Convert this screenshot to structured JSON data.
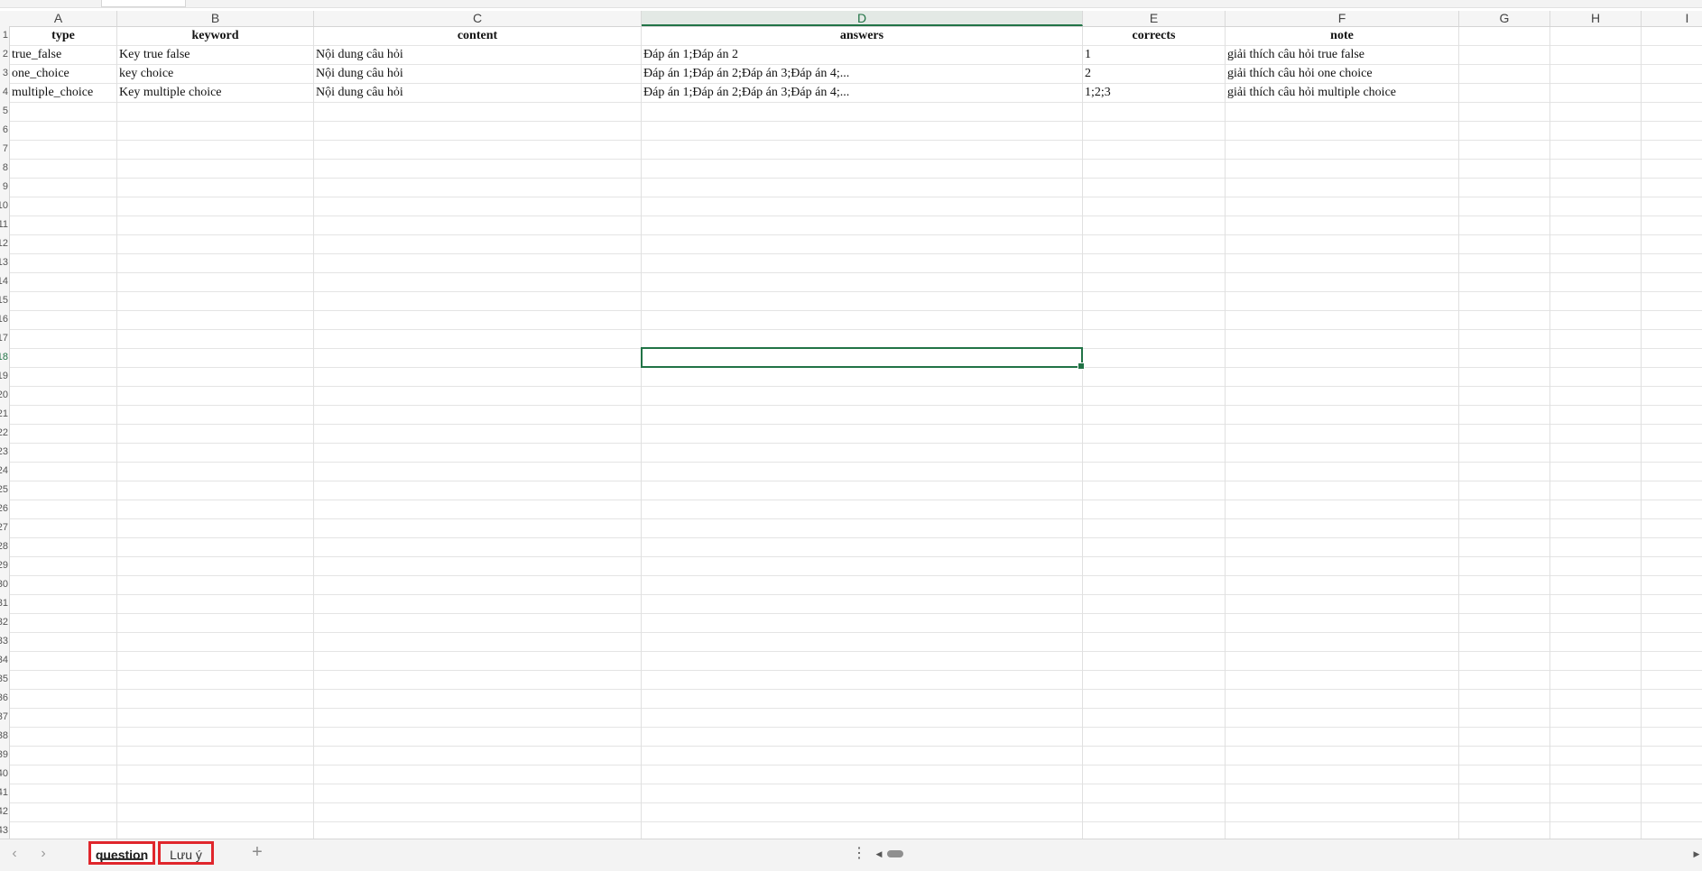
{
  "columns": [
    "A",
    "B",
    "C",
    "D",
    "E",
    "F",
    "G",
    "H",
    "I"
  ],
  "selected_column": "D",
  "header_row": {
    "type": "type",
    "keyword": "keyword",
    "content": "content",
    "answers": "answers",
    "corrects": "corrects",
    "note": "note"
  },
  "rows": [
    {
      "type": "true_false",
      "keyword": "Key true false",
      "content": "Nội dung câu hỏi",
      "answers": "Đáp án 1;Đáp án 2",
      "corrects": "1",
      "note": "giải thích câu hỏi true false"
    },
    {
      "type": "one_choice",
      "keyword": "key choice",
      "content": "Nội dung câu hỏi",
      "answers": "Đáp án 1;Đáp án 2;Đáp án 3;Đáp án 4;...",
      "corrects": "2",
      "note": "giải thích câu hỏi one choice"
    },
    {
      "type": "multiple_choice",
      "keyword": "Key multiple choice",
      "content": "Nội dung câu hỏi",
      "answers": "Đáp án 1;Đáp án 2;Đáp án 3;Đáp án 4;...",
      "corrects": "1;2;3",
      "note": "giải thích câu hỏi multiple choice"
    }
  ],
  "row_numbers": [
    "1",
    "2",
    "3",
    "4",
    "5",
    "6",
    "7",
    "8",
    "9",
    "10",
    "11",
    "12",
    "13",
    "14",
    "15",
    "16",
    "17",
    "18",
    "19",
    "20",
    "21",
    "22",
    "23",
    "24",
    "25",
    "26",
    "27",
    "28",
    "29",
    "30",
    "31",
    "32",
    "33",
    "34",
    "35",
    "36",
    "37",
    "38",
    "39",
    "40",
    "41",
    "42",
    "43"
  ],
  "selected_row": "18",
  "sheet_tabs": [
    {
      "label": "question",
      "active": true
    },
    {
      "label": "Lưu ý",
      "active": false
    }
  ],
  "nav": {
    "prev_icon": "‹",
    "next_icon": "›",
    "add_icon": "+",
    "menu_icon": "⋮",
    "scroll_left": "◀",
    "scroll_right": "▶"
  },
  "colors": {
    "accent": "#217346",
    "tab_highlight": "#e0262c"
  }
}
